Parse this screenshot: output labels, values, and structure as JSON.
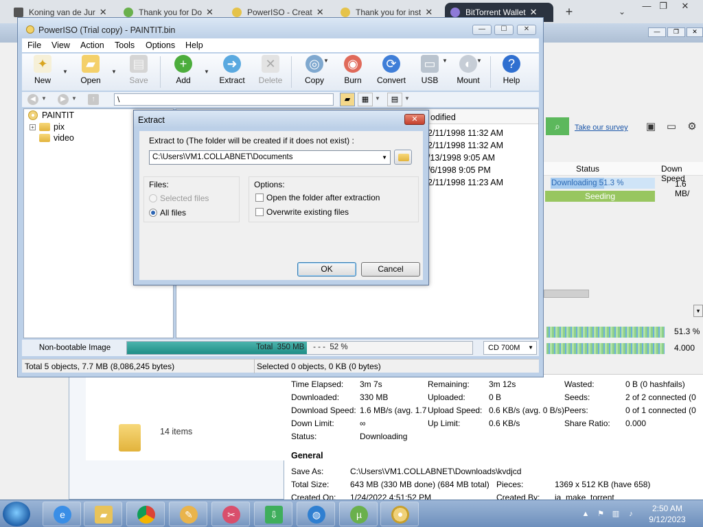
{
  "browser": {
    "tabs": [
      {
        "label": "Koning van de Jur",
        "icon": "bank-icon",
        "active": false
      },
      {
        "label": "Thank you for Do",
        "icon": "utorrent-icon",
        "active": false
      },
      {
        "label": "PowerISO - Creat",
        "icon": "poweriso-icon",
        "active": false
      },
      {
        "label": "Thank you for inst",
        "icon": "poweriso-icon",
        "active": false
      },
      {
        "label": "BitTorrent Wallet",
        "icon": "bittorrent-icon",
        "active": true
      }
    ],
    "new_tab_icon": "plus-icon"
  },
  "poweriso": {
    "title": "PowerISO (Trial copy) - PAINTIT.bin",
    "menu": [
      "File",
      "View",
      "Action",
      "Tools",
      "Options",
      "Help"
    ],
    "toolbar": {
      "new": "New",
      "open": "Open",
      "save": "Save",
      "add": "Add",
      "extract": "Extract",
      "delete": "Delete",
      "copy": "Copy",
      "burn": "Burn",
      "convert": "Convert",
      "usb": "USB",
      "mount": "Mount",
      "help": "Help"
    },
    "path": "\\",
    "tree": {
      "root": "PAINTIT",
      "children": [
        "pix",
        "video"
      ]
    },
    "list": {
      "header_partial": "odified",
      "dates": [
        "2/11/1998 11:32 AM",
        "2/11/1998 11:32 AM",
        "/13/1998 9:05 AM",
        "/6/1998 9:05 PM",
        "2/11/1998 11:23 AM"
      ]
    },
    "statusbar": {
      "image_type": "Non-bootable Image",
      "progress_text": "Total  350 MB    - - -  52 %",
      "progress_fraction": 0.52,
      "media": "CD 700M"
    },
    "bottom": {
      "left": "Total 5 objects, 7.7 MB (8,086,245 bytes)",
      "right": "Selected 0 objects, 0 KB (0 bytes)"
    }
  },
  "extract_dialog": {
    "title": "Extract",
    "close": "✕",
    "prompt": "Extract to (The folder will be created if it does not exist) :",
    "path": "C:\\Users\\VM1.COLLABNET\\Documents",
    "files_label": "Files:",
    "selected_files": "Selected files",
    "all_files": "All files",
    "options_label": "Options:",
    "open_folder": "Open the folder after extraction",
    "overwrite": "Overwrite existing files",
    "ok": "OK",
    "cancel": "Cancel"
  },
  "bittorrent": {
    "survey_link": "Take our survey",
    "col_status": "Status",
    "col_down": "Down Speed",
    "row_status": "Downloading 51.3 %",
    "row_fraction": 0.513,
    "row_speed": "1.6 MB/",
    "seeding": "Seeding",
    "strip1": "51.3 %",
    "strip2": "4.000",
    "info": {
      "time_elapsed_l": "Time Elapsed:",
      "time_elapsed": "3m 7s",
      "remaining_l": "Remaining:",
      "remaining": "3m 12s",
      "wasted_l": "Wasted:",
      "wasted": "0 B (0 hashfails)",
      "downloaded_l": "Downloaded:",
      "downloaded": "330 MB",
      "uploaded_l": "Uploaded:",
      "uploaded": "0 B",
      "seeds_l": "Seeds:",
      "seeds": "2 of 2 connected (0",
      "down_speed_l": "Download Speed:",
      "down_speed": "1.6 MB/s (avg. 1.7",
      "up_speed_l": "Upload Speed:",
      "up_speed": "0.6 KB/s (avg. 0 B/s)",
      "peers_l": "Peers:",
      "peers": "0 of 1 connected (0",
      "down_limit_l": "Down Limit:",
      "down_limit": "∞",
      "up_limit_l": "Up Limit:",
      "up_limit": "0.6 KB/s",
      "share_l": "Share Ratio:",
      "share": "0.000",
      "status_l": "Status:",
      "status": "Downloading",
      "general": "General",
      "save_as_l": "Save As:",
      "save_as": "C:\\Users\\VM1.COLLABNET\\Downloads\\kvdjcd",
      "total_size_l": "Total Size:",
      "total_size": "643 MB (330 MB done) (684 MB total)",
      "pieces_l": "Pieces:",
      "pieces": "1369 x 512 KB (have 658)",
      "created_on_l": "Created On:",
      "created_on": "1/24/2022 4:51:52 PM",
      "created_by_l": "Created By:",
      "created_by": "ia_make_torrent"
    }
  },
  "explorer": {
    "items": "14 items"
  },
  "taskbar": {
    "time": "2:50 AM",
    "date": "9/12/2023"
  },
  "colors": {
    "accent": "#2b3340",
    "progress": "#1f8e87",
    "bt_green": "#98c660",
    "bt_blue": "#2c6ab5"
  }
}
